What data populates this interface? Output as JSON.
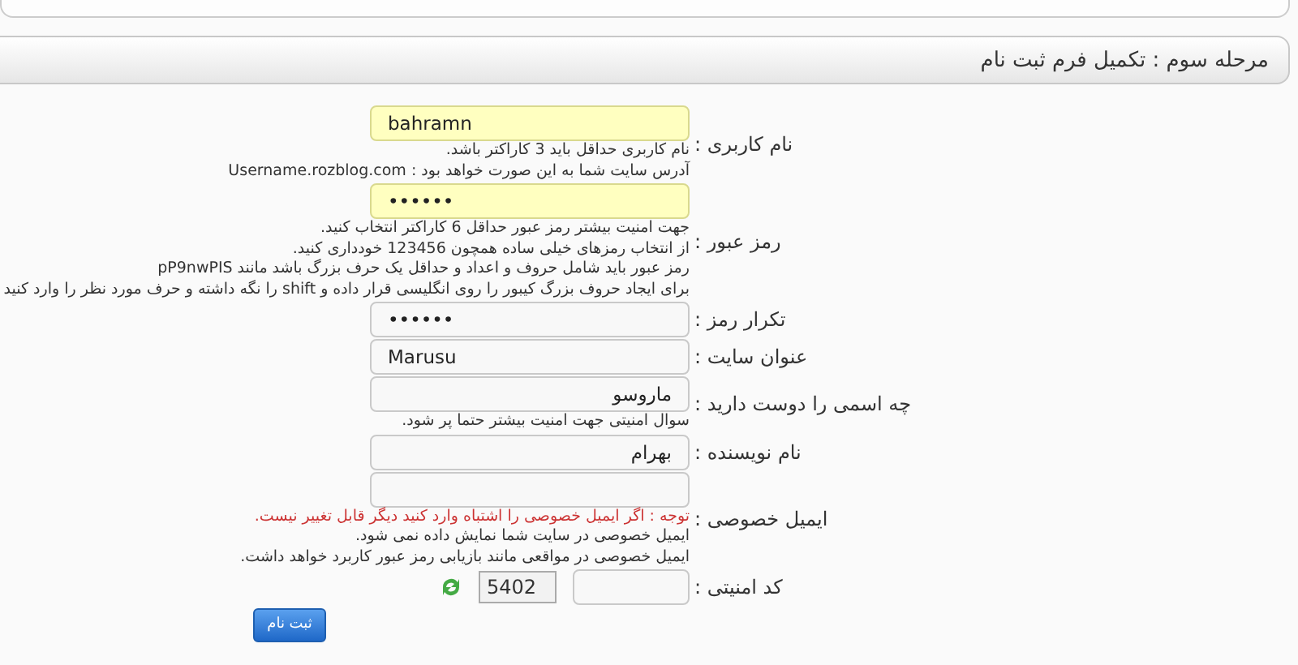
{
  "header": {
    "title": "مرحله سوم : تکمیل فرم ثبت نام"
  },
  "fields": [
    {
      "kind": "text",
      "label": "نام کاربری :",
      "value": "bahramn",
      "highlighted": true,
      "hints": [
        {
          "kind": "note",
          "text": "نام کاربری حداقل باید 3 کاراکتر باشد."
        },
        {
          "kind": "note",
          "text": "آدرس سایت شما به این صورت خواهد بود : Username.rozblog.com"
        }
      ]
    },
    {
      "kind": "text",
      "label": "رمز عبور :",
      "value": "••••••",
      "highlighted": true,
      "hints": [
        {
          "kind": "note",
          "text": "جهت امنیت بیشتر رمز عبور حداقل 6 کاراکتر انتخاب کنید."
        },
        {
          "kind": "note",
          "text": "از انتخاب رمزهای خیلی ساده همچون 123456 خودداری کنید."
        },
        {
          "kind": "note",
          "text": "رمز عبور باید شامل حروف و اعداد و حداقل یک حرف بزرگ باشد مانند pP9nwPIS"
        },
        {
          "kind": "note",
          "text": "برای ایجاد حروف بزرگ کیبور را روی انگلیسی قرار داده و shift را نگه داشته و حرف مورد نظر را وارد کنید"
        }
      ]
    },
    {
      "kind": "text",
      "label": "تکرار رمز :",
      "value": "••••••",
      "highlighted": false
    },
    {
      "kind": "text",
      "label": "عنوان سایت :",
      "value": "Marusu",
      "highlighted": false
    },
    {
      "kind": "text",
      "label": "چه اسمی را دوست دارید :",
      "value": "ماروسو",
      "highlighted": false,
      "hints": [
        {
          "kind": "note",
          "text": "سوال امنیتی جهت امنیت بیشتر حتما پر شود."
        }
      ]
    },
    {
      "kind": "text",
      "label": "نام نویسنده :",
      "value": "بهرام",
      "highlighted": false
    },
    {
      "kind": "text",
      "label": "ایمیل خصوصی :",
      "highlighted": false,
      "hints": [
        {
          "kind": "warning",
          "text": "توجه : اگر ایمیل خصوصی را اشتباه وارد کنید دیگر قابل تغییر نیست."
        },
        {
          "kind": "note",
          "text": "ایمیل خصوصی در سایت شما نمایش داده نمی شود."
        },
        {
          "kind": "note",
          "text": "ایمیل خصوصی در مواقعی مانند بازیابی رمز عبور کاربرد خواهد داشت."
        }
      ]
    },
    {
      "kind": "captcha",
      "label": "کد امنیتی :",
      "captcha_code": "5402",
      "highlighted": false
    }
  ],
  "submit": {
    "label": "ثبت نام"
  }
}
